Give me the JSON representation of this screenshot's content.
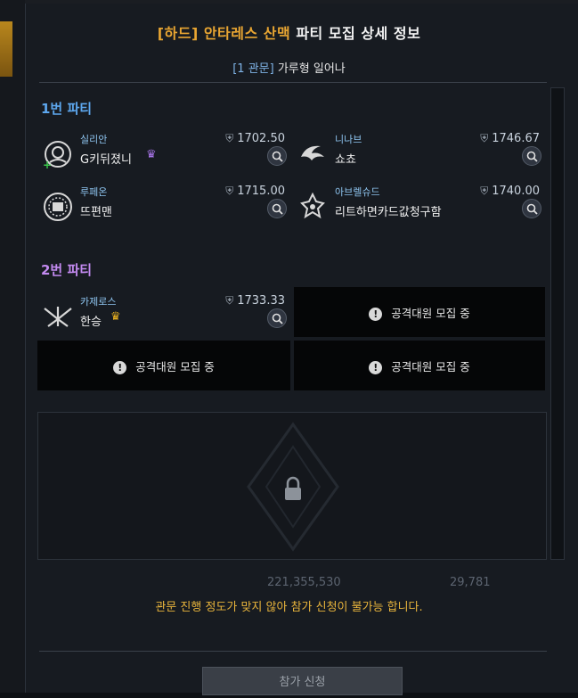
{
  "dialog": {
    "title_highlight": "[하드] 안타레스 산맥",
    "title_rest": "파티 모집 상세 정보",
    "subtitle_bracket": "[1 관문]",
    "subtitle_text": "가루형 일어나"
  },
  "party1": {
    "label": "1번 파티",
    "members": [
      {
        "class": "실리안",
        "nick": "G키뒤졌니",
        "ilvl": "1702.50",
        "crown": "purple",
        "class_icon": "sylian-class-icon"
      },
      {
        "class": "니나브",
        "nick": "쇼쵸",
        "ilvl": "1746.67",
        "class_icon": "ninav-class-icon"
      },
      {
        "class": "루페온",
        "nick": "뜨편맨",
        "ilvl": "1715.00",
        "class_icon": "lupeon-class-icon"
      },
      {
        "class": "아브렐슈드",
        "nick": "리트하면카드값청구함",
        "ilvl": "1740.00",
        "class_icon": "abrelshud-class-icon"
      }
    ]
  },
  "party2": {
    "label": "2번 파티",
    "members": [
      {
        "class": "카제로스",
        "nick": "한승",
        "ilvl": "1733.33",
        "crown": "gold",
        "class_icon": "kazeros-class-icon"
      }
    ],
    "recruiting_text": "공격대원 모집 중"
  },
  "bottom": {
    "silver": "221,355,530",
    "gold": "29,781",
    "warning": "관문 진행 정도가 맞지 않아 참가 신청이 불가능 합니다.",
    "apply_label": "참가 신청"
  },
  "colors": {
    "accent_gold": "#e8a532",
    "party1_blue": "#5da7ee",
    "party2_purple": "#c38af0",
    "warning_yellow": "#e8b43c"
  }
}
